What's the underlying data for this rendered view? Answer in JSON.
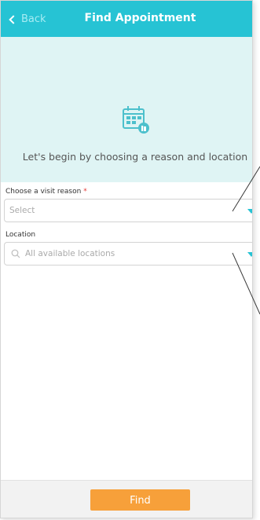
{
  "header": {
    "back_label": "Back",
    "title": "Find Appointment"
  },
  "hero": {
    "icon": "calendar-icon",
    "message": "Let's begin by choosing a reason and location"
  },
  "form": {
    "reason": {
      "label": "Choose a visit reason",
      "required_mark": "*",
      "placeholder": "Select"
    },
    "location": {
      "label": "Location",
      "placeholder": "All available locations",
      "icon": "search-icon"
    }
  },
  "footer": {
    "find_label": "Find"
  },
  "colors": {
    "header": "#26c3d4",
    "hero_bg": "#dff4f4",
    "accent": "#26c3d4",
    "button": "#f7a03a",
    "required": "#e53935"
  }
}
